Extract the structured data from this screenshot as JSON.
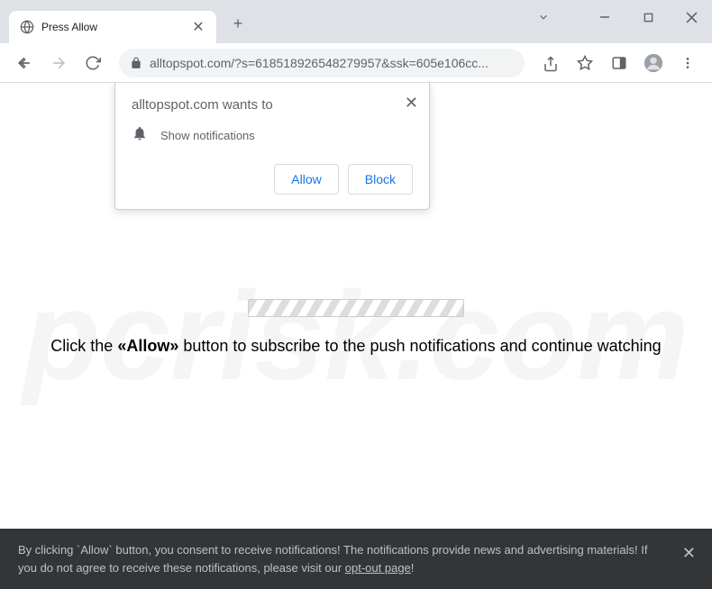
{
  "tab": {
    "title": "Press Allow"
  },
  "address": {
    "url": "alltopspot.com/?s=618518926548279957&ssk=605e106cc..."
  },
  "popup": {
    "title": "alltopspot.com wants to",
    "permission": "Show notifications",
    "allow": "Allow",
    "block": "Block"
  },
  "page": {
    "text_pre": "Click the ",
    "text_bold": "«Allow»",
    "text_post": " button to subscribe to the push notifications and continue watching"
  },
  "consent": {
    "text_a": "By clicking `Allow` button, you consent to receive notifications! The notifications provide news and advertising materials! If you do not agree to receive these notifications, please visit our ",
    "link": "opt-out page",
    "text_b": "!"
  },
  "watermark": "pcrisk.com"
}
